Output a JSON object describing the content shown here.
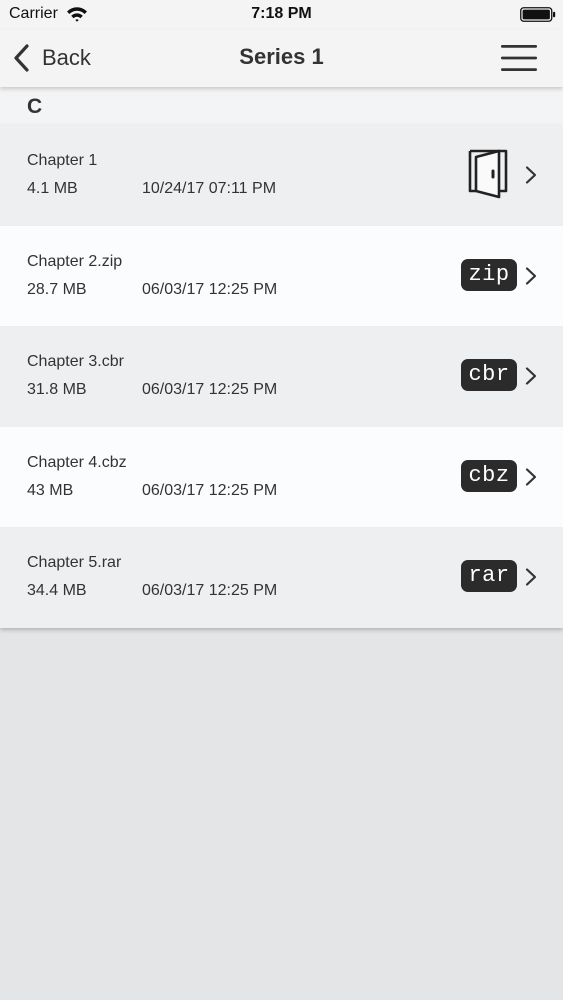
{
  "status_bar": {
    "carrier": "Carrier",
    "time": "7:18 PM",
    "wifi_icon": "wifi-icon",
    "battery_icon": "battery-icon"
  },
  "nav": {
    "back_label": "Back",
    "title": "Series 1",
    "menu_icon": "hamburger-menu-icon"
  },
  "section": {
    "letter": "C"
  },
  "files": [
    {
      "name": "Chapter 1",
      "size": "4.1 MB",
      "date": "10/24/17 07:11 PM",
      "kind": "folder",
      "icon": "open-door-folder-icon"
    },
    {
      "name": "Chapter 2.zip",
      "size": "28.7 MB",
      "date": "06/03/17 12:25 PM",
      "kind": "badge",
      "badge": "zip"
    },
    {
      "name": "Chapter 3.cbr",
      "size": "31.8 MB",
      "date": "06/03/17 12:25 PM",
      "kind": "badge",
      "badge": "cbr"
    },
    {
      "name": "Chapter 4.cbz",
      "size": "43 MB",
      "date": "06/03/17 12:25 PM",
      "kind": "badge",
      "badge": "cbz"
    },
    {
      "name": "Chapter 5.rar",
      "size": "34.4 MB",
      "date": "06/03/17 12:25 PM",
      "kind": "badge",
      "badge": "rar"
    }
  ],
  "colors": {
    "badge_background": "#2b2b2b",
    "row_dark": "#eeeff0",
    "row_light": "#fbfcfd",
    "empty_background": "#e4e5e6"
  }
}
